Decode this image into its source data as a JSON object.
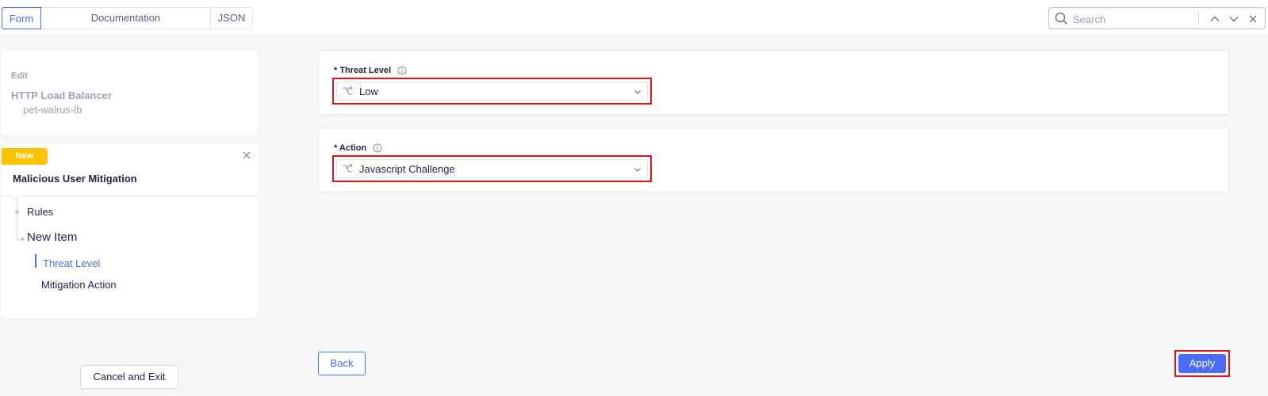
{
  "tabs": [
    {
      "label": "Form",
      "active": true
    },
    {
      "label": "Documentation",
      "active": false
    },
    {
      "label": "JSON",
      "active": false
    }
  ],
  "search": {
    "placeholder": "Search",
    "value": ""
  },
  "edit_card": {
    "label": "Edit",
    "title": "HTTP Load Balancer",
    "name": "pet-walrus-lb"
  },
  "nav": {
    "badge": "New",
    "title": "Malicious User Mitigation",
    "items": [
      {
        "label": "Rules"
      },
      {
        "label": "New Item"
      },
      {
        "label": "Threat Level",
        "selected": true
      },
      {
        "label": "Mitigation Action"
      }
    ]
  },
  "form": {
    "threat_level": {
      "label": "* Threat Level",
      "value": "Low"
    },
    "action": {
      "label": "* Action",
      "value": "Javascript Challenge"
    }
  },
  "buttons": {
    "cancel": "Cancel and Exit",
    "back": "Back",
    "apply": "Apply"
  },
  "colors": {
    "accent": "#4a6cf7",
    "badge": "#ffc300",
    "highlight": "#e3141c"
  },
  "icons": [
    "search-icon",
    "chevron-up-icon",
    "chevron-down-icon",
    "close-icon",
    "info-icon",
    "route-icon"
  ]
}
